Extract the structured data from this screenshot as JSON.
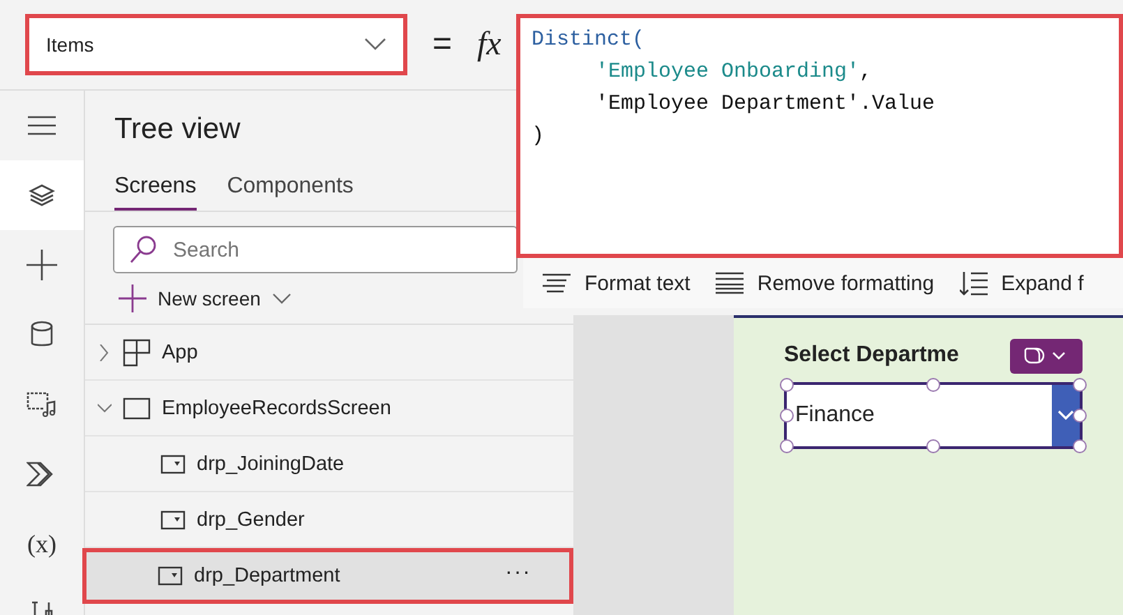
{
  "property_dropdown": {
    "value": "Items",
    "highlighted": true
  },
  "formula_bar": {
    "equals": "=",
    "fx": "fx",
    "highlighted": true,
    "lines": [
      {
        "indented": false,
        "tokens": [
          {
            "kind": "function",
            "text": "Distinct("
          }
        ]
      },
      {
        "indented": true,
        "tokens": [
          {
            "kind": "string",
            "text": "'Employee Onboarding'"
          },
          {
            "kind": "plain",
            "text": ","
          }
        ]
      },
      {
        "indented": true,
        "tokens": [
          {
            "kind": "plain",
            "text": "'Employee Department'.Value"
          }
        ]
      },
      {
        "indented": false,
        "tokens": [
          {
            "kind": "plain",
            "text": ")"
          }
        ]
      }
    ]
  },
  "format_toolbar": [
    {
      "kind": "format",
      "label": "Format text"
    },
    {
      "kind": "remove",
      "label": "Remove formatting"
    },
    {
      "kind": "expand",
      "label": "Expand f"
    }
  ],
  "rail": [
    {
      "kind": "menu",
      "selected": false
    },
    {
      "kind": "layers",
      "selected": true
    },
    {
      "kind": "plus",
      "selected": false
    },
    {
      "kind": "database",
      "selected": false
    },
    {
      "kind": "media",
      "selected": false
    },
    {
      "kind": "automate",
      "selected": false
    },
    {
      "kind": "variables",
      "label": "(x)",
      "selected": false
    },
    {
      "kind": "tools",
      "selected": false
    }
  ],
  "tree_view": {
    "title": "Tree view",
    "tabs": [
      {
        "label": "Screens",
        "selected": true
      },
      {
        "label": "Components",
        "selected": false
      }
    ],
    "search": {
      "placeholder": "Search"
    },
    "new_screen": "New screen",
    "items": [
      {
        "kind": "app",
        "label": "App",
        "expanded": false,
        "selected": false
      },
      {
        "kind": "screen",
        "label": "EmployeeRecordsScreen",
        "expanded": true,
        "selected": false,
        "children": [
          {
            "kind": "dropdown",
            "label": "drp_JoiningDate",
            "selected": false,
            "highlighted": false
          },
          {
            "kind": "dropdown",
            "label": "drp_Gender",
            "selected": false,
            "highlighted": false
          },
          {
            "kind": "dropdown",
            "label": "drp_Department",
            "selected": true,
            "highlighted": true,
            "more": "···"
          }
        ]
      }
    ]
  },
  "canvas": {
    "label": "Select Departme",
    "dropdown": {
      "value": "Finance",
      "selected": true
    }
  }
}
